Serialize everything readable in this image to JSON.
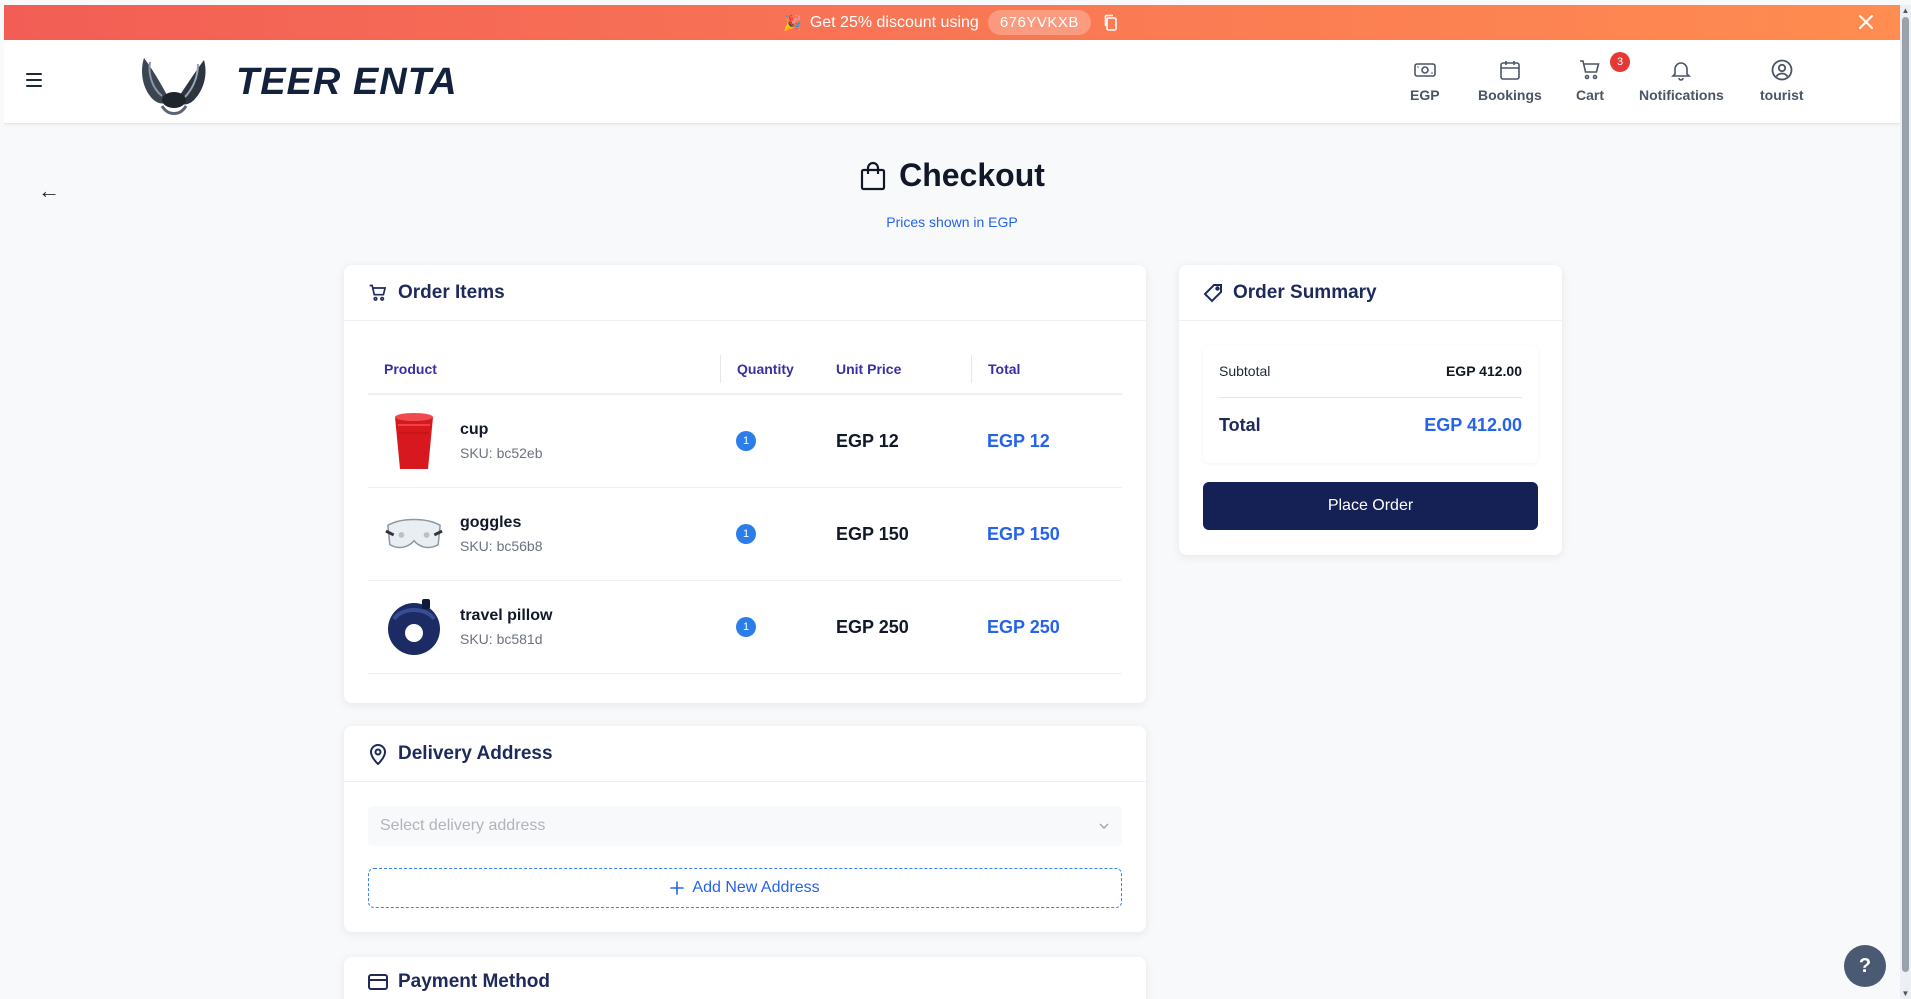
{
  "promo": {
    "text": "Get 25% discount using",
    "code": "676YVKXB"
  },
  "nav": {
    "brand": "TEER ENTA",
    "items": [
      {
        "label": "EGP",
        "icon": "currency-icon"
      },
      {
        "label": "Bookings",
        "icon": "calendar-icon"
      },
      {
        "label": "Cart",
        "icon": "cart-icon",
        "badge": "3"
      },
      {
        "label": "Notifications",
        "icon": "bell-icon"
      },
      {
        "label": "tourist",
        "icon": "user-icon"
      }
    ]
  },
  "page": {
    "title": "Checkout",
    "subtitle": "Prices shown in EGP"
  },
  "order_items": {
    "heading": "Order Items",
    "columns": [
      "Product",
      "Quantity",
      "Unit Price",
      "Total"
    ],
    "rows": [
      {
        "name": "cup",
        "sku": "SKU: bc52eb",
        "qty": "1",
        "unit_price": "EGP 12",
        "total": "EGP 12"
      },
      {
        "name": "goggles",
        "sku": "SKU: bc56b8",
        "qty": "1",
        "unit_price": "EGP 150",
        "total": "EGP 150"
      },
      {
        "name": "travel pillow",
        "sku": "SKU: bc581d",
        "qty": "1",
        "unit_price": "EGP 250",
        "total": "EGP 250"
      }
    ]
  },
  "delivery": {
    "heading": "Delivery Address",
    "select_placeholder": "Select delivery address",
    "add_label": "Add New Address"
  },
  "payment": {
    "heading": "Payment Method"
  },
  "summary": {
    "heading": "Order Summary",
    "subtotal_label": "Subtotal",
    "subtotal_value": "EGP 412.00",
    "total_label": "Total",
    "total_value": "EGP 412.00",
    "place_order": "Place Order"
  },
  "help": {
    "label": "?"
  },
  "colors": {
    "primary_navy": "#152155",
    "accent_blue": "#2563eb",
    "promo_start": "#f25e55",
    "promo_end": "#ff8c50",
    "badge_red": "#e53935"
  }
}
